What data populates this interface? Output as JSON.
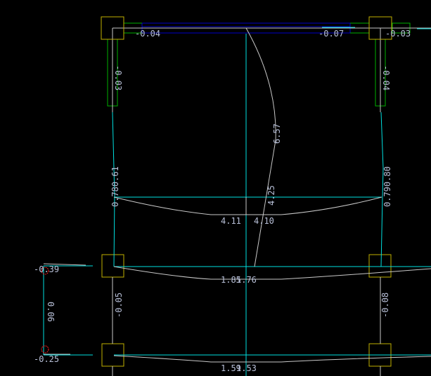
{
  "colors": {
    "background": "#000000",
    "column": "#c0b000",
    "beam_top": "#0000c8",
    "wall": "#00b000",
    "axis": "#00e0e0",
    "diagram": "#c8c8c8",
    "label": "#b8c0d8",
    "marker": "#ff2020"
  },
  "labels": {
    "top_left_moment": "-0.04",
    "top_mid_moment": "-0.07",
    "top_right_moment": "-0.03",
    "left_wall_moment": "-0.03",
    "right_wall_moment": "-0.04",
    "vertical_span_moment": "6.57",
    "vertical_span_moment_2": "4.25",
    "left_end_moments": "0.780.61",
    "right_end_moments": "0.790.80",
    "mid_span_left": "4.11",
    "mid_span_right": "4.10",
    "beam2_left": "1.85",
    "beam2_right": "1.76",
    "cantilever_top": "-0.39",
    "cantilever_span": "0.06",
    "left_column_moment": "-0.05",
    "right_column_moment": "-0.08",
    "cantilever_bottom": "-0.25",
    "beam3_left": "1.59",
    "beam3_right": "1.53"
  }
}
